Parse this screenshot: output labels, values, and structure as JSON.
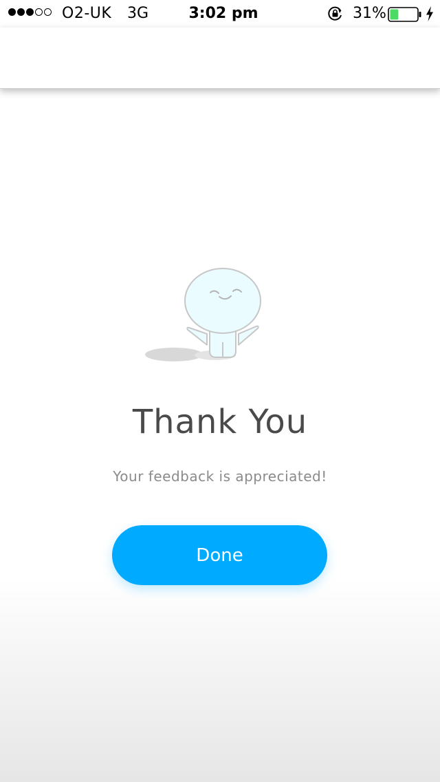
{
  "status_bar": {
    "carrier": "O2-UK",
    "network": "3G",
    "time": "3:02 pm",
    "battery_percent": "31%",
    "battery_level": 0.31,
    "signal_strength": 3,
    "signal_max": 5,
    "icons": {
      "orientation_lock": "orientation-lock-icon",
      "battery": "battery-icon",
      "charging": "charging-bolt-icon"
    }
  },
  "main": {
    "title": "Thank You",
    "subtitle": "Your feedback is appreciated!",
    "done_label": "Done",
    "illustration": "mascot-waving-illustration"
  },
  "colors": {
    "accent": "#00aaff",
    "title_text": "#4a4a4a",
    "subtitle_text": "#8a8a8a",
    "battery_fill": "#4cd964",
    "mascot_fill": "#eafcff"
  }
}
